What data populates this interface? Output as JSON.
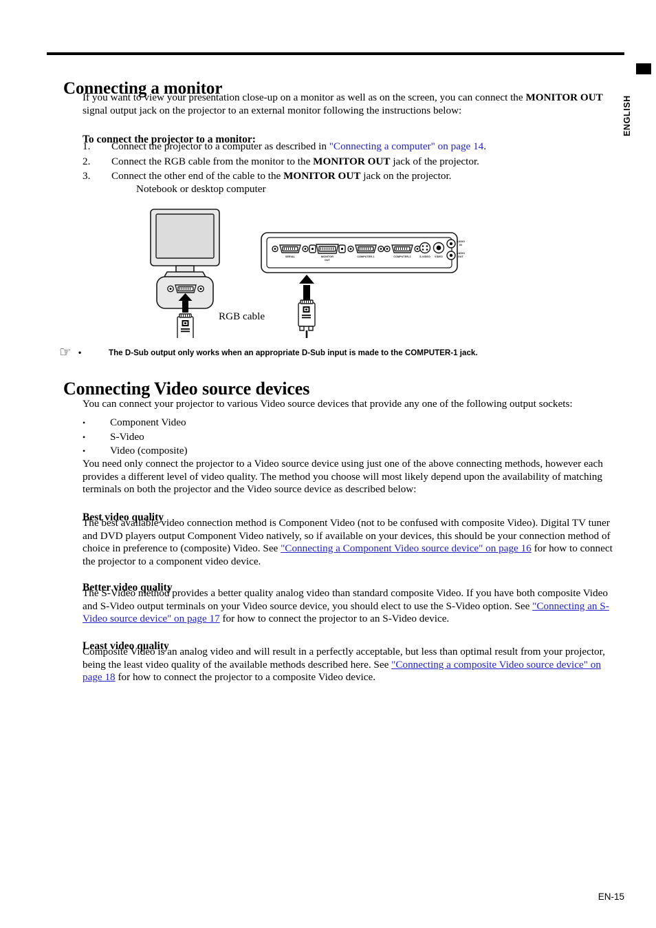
{
  "sidebar": {
    "language_tab": "ENGLISH"
  },
  "footer": {
    "page_number": "EN-15"
  },
  "sections": {
    "monitor": {
      "heading": "Connecting a monitor",
      "intro_part1": "If you want to view your presentation close-up on a monitor as well as on the screen, you can connect the ",
      "intro_bold1": "MONITOR OUT",
      "intro_part2": " signal output jack on the projector to an external monitor following the instructions below:",
      "subheading": "To connect the projector to a monitor:",
      "steps": [
        {
          "number": "1.",
          "text_before": "Connect the projector to a computer as described in ",
          "link": "\"Connecting a computer\" on page 14",
          "text_after": "."
        },
        {
          "number": "2.",
          "text_before": "Connect the RGB cable from the monitor to the ",
          "bold": "MONITOR OUT",
          "text_after": " jack of the projector."
        },
        {
          "number": "3.",
          "text_before": "Connect the other end of the cable to the ",
          "bold": "MONITOR OUT",
          "text_after": " jack on the projector."
        }
      ],
      "note": {
        "hand_icon": "pointing-hand-icon",
        "bullet": "•",
        "text": "The D-Sub output only works when an appropriate D-Sub input is made to the COMPUTER-1 jack."
      }
    },
    "video": {
      "heading": "Connecting Video source devices",
      "intro": "You can connect your projector to various Video source devices that provide any one of the following output sockets:",
      "bullets": [
        "Component Video",
        "S-Video",
        "Video (composite)"
      ],
      "after_bullets": "You need only connect the projector to a Video source device using just one of the above connecting methods, however each provides a different level of video quality. The method you choose will most likely depend upon the availability of matching terminals on both the projector and the Video source device as described below:",
      "quality": [
        {
          "heading": "Best video quality",
          "text_before": "The best available video connection method is Component Video (not to be confused with composite Video). Digital TV tuner and DVD players output Component Video natively, so if available on your devices, this should be your connection method of choice in preference to (composite) Video. See ",
          "link": "\"Connecting a Component Video source device\" on page 16",
          "text_after": " for how to connect the projector to a component video device."
        },
        {
          "heading": "Better video quality",
          "text_before": "The S-Video method provides a better quality analog video than standard composite Video. If you have both composite Video and S-Video output terminals on your Video source device, you should elect to use the S-Video option. See ",
          "link": "\"Connecting an S-Video source device\" on page 17",
          "text_after": " for how to connect the projector to an S-Video device."
        },
        {
          "heading": "Least video quality",
          "text_before": "Composite Video is an analog video and will result in a perfectly acceptable, but less than optimal result from your projector, being the least video quality of the available methods described here. See ",
          "link": "\"Connecting a composite Video source device\" on page 18",
          "text_after": " for how to connect the projector to a composite Video device."
        }
      ]
    }
  },
  "figure": {
    "caption": "Notebook or desktop computer",
    "cable_label": "RGB cable",
    "projector_ports": [
      "SERIAL",
      "MONITOR OUT",
      "COMPUTER-1",
      "COMPUTER-2",
      "S-VIDEO",
      "VIDEO",
      "AUDIO IN",
      "AUDIO OUT"
    ],
    "port_label_monitor_out_line1": "MONITOR",
    "port_label_monitor_out_line2": "OUT",
    "port_label_audio_in_line1": "AUDIO",
    "port_label_audio_in_line2": "IN",
    "port_label_audio_out_line1": "AUDIO",
    "port_label_audio_out_line2": "OUT"
  },
  "colors": {
    "link": "#2222cc",
    "text": "#000000",
    "device_fill": "#e8e8e8",
    "screen_fill": "#dcdcdc"
  }
}
